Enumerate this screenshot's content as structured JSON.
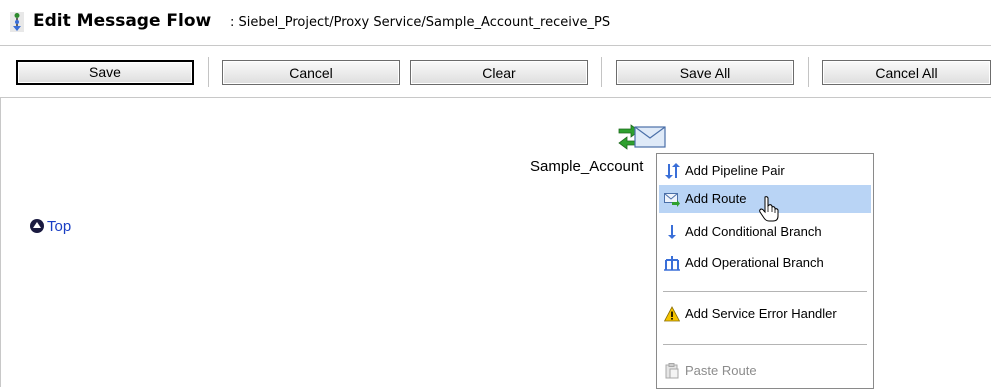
{
  "header": {
    "title": "Edit Message Flow",
    "separator": ":",
    "path": "Siebel_Project/Proxy Service/Sample_Account_receive_PS"
  },
  "toolbar": {
    "save": "Save",
    "cancel": "Cancel",
    "clear": "Clear",
    "save_all": "Save All",
    "cancel_all": "Cancel All"
  },
  "canvas": {
    "node_label": "Sample_Account",
    "node_icon": "proxy-service-envelope-icon",
    "top_link": "Top"
  },
  "context_menu": {
    "items": [
      {
        "label": "Add Pipeline Pair",
        "icon": "pipeline-pair-icon"
      },
      {
        "label": "Add Route",
        "icon": "route-icon",
        "highlighted": true
      },
      {
        "label": "Add Conditional Branch",
        "icon": "conditional-branch-icon"
      },
      {
        "label": "Add Operational Branch",
        "icon": "operational-branch-icon"
      },
      {
        "label": "Add Service Error Handler",
        "icon": "warning-icon"
      },
      {
        "label": "Paste Route",
        "icon": "paste-icon",
        "disabled": true
      }
    ]
  },
  "colors": {
    "highlight": "#b9d4f5",
    "link": "#1a3fc4"
  }
}
